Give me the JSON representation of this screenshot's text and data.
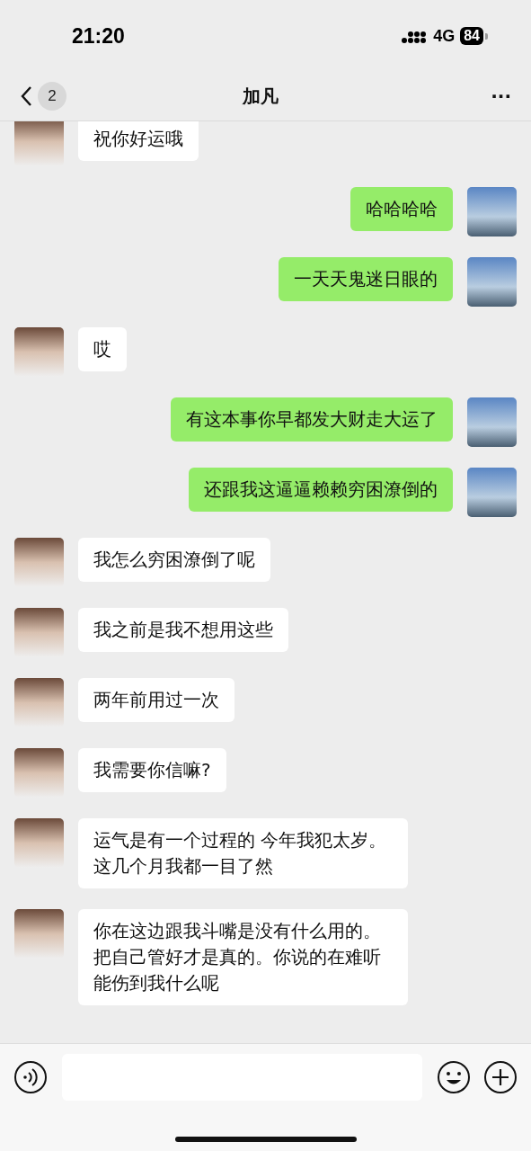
{
  "status_bar": {
    "time": "21:20",
    "network": "4G",
    "battery": "84"
  },
  "nav": {
    "back_badge": "2",
    "title": "加凡",
    "more": "···"
  },
  "messages": [
    {
      "kind": "received",
      "text": "祝你好运哦"
    },
    {
      "kind": "sent",
      "text": "哈哈哈哈"
    },
    {
      "kind": "sent",
      "text": "一天天鬼迷日眼的"
    },
    {
      "kind": "received",
      "text": "哎"
    },
    {
      "kind": "sent",
      "text": "有这本事你早都发大财走大运了"
    },
    {
      "kind": "sent",
      "text": "还跟我这逼逼赖赖穷困潦倒的"
    },
    {
      "kind": "received",
      "text": "我怎么穷困潦倒了呢"
    },
    {
      "kind": "received",
      "text": "我之前是我不想用这些"
    },
    {
      "kind": "received",
      "text": "两年前用过一次"
    },
    {
      "kind": "received",
      "text": "我需要你信嘛?"
    },
    {
      "kind": "received",
      "text": "运气是有一个过程的 今年我犯太岁。这几个月我都一目了然"
    },
    {
      "kind": "received",
      "text": "你在这边跟我斗嘴是没有什么用的。把自己管好才是真的。你说的在难听能伤到我什么呢"
    }
  ]
}
